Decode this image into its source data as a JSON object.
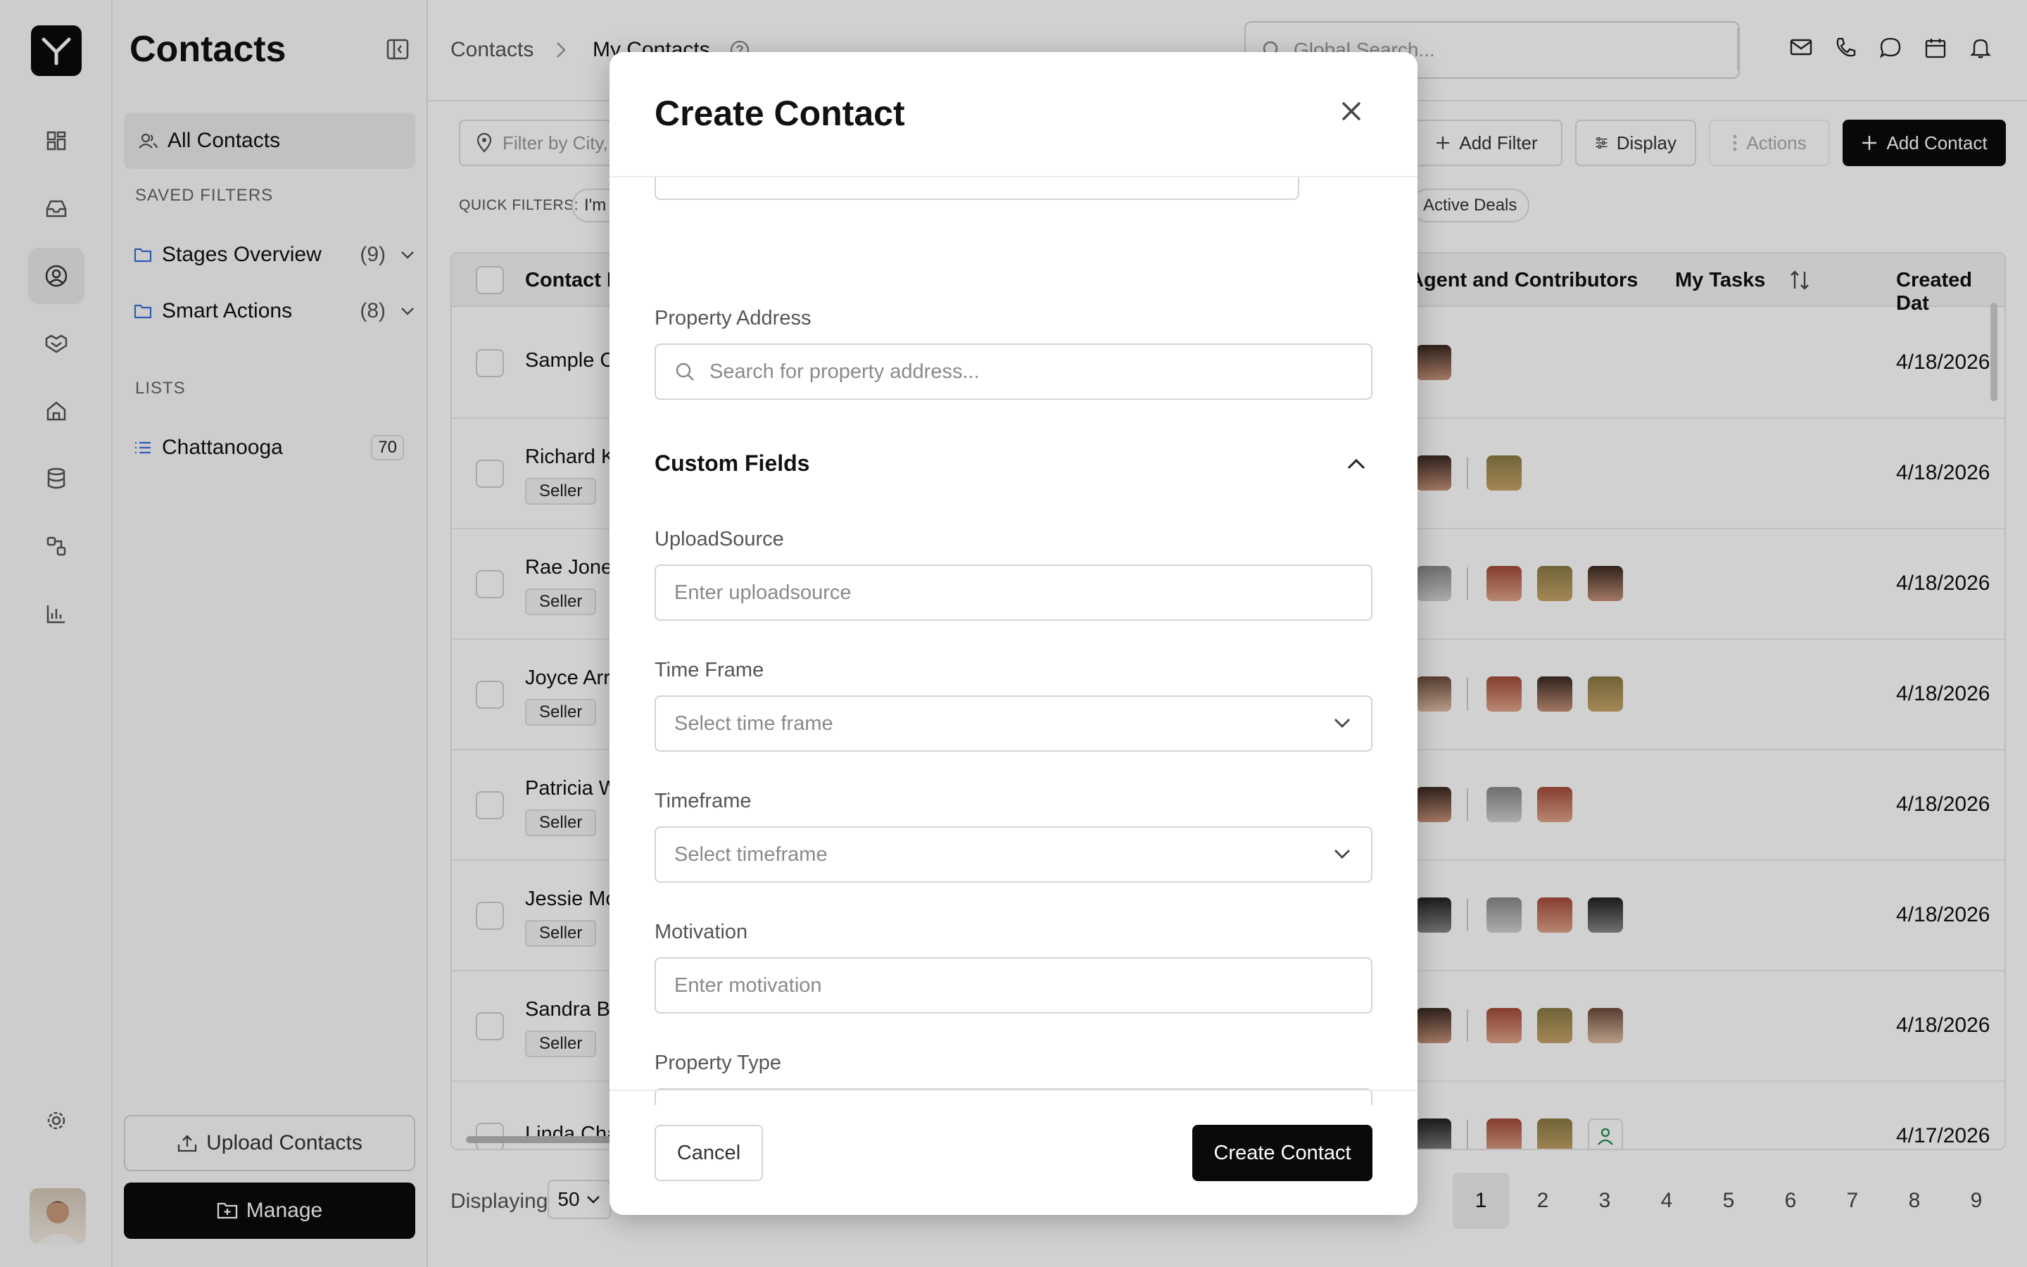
{
  "sidebar": {
    "title": "Contacts",
    "all_contacts": "All Contacts",
    "saved_filters_heading": "SAVED FILTERS",
    "saved_filters": [
      {
        "label": "Stages Overview",
        "count": "(9)"
      },
      {
        "label": "Smart Actions",
        "count": "(8)"
      }
    ],
    "lists_heading": "LISTS",
    "lists": [
      {
        "label": "Chattanooga",
        "count": "70"
      }
    ],
    "upload_label": "Upload Contacts",
    "manage_label": "Manage"
  },
  "header": {
    "breadcrumb_root": "Contacts",
    "breadcrumb_current": "My Contacts",
    "global_search_placeholder": "Global Search..."
  },
  "toolbar": {
    "filter_placeholder": "Filter by City, S",
    "add_filter": "Add Filter",
    "display": "Display",
    "actions": "Actions",
    "add_contact": "Add Contact",
    "quick_filters_label": "QUICK FILTERS:",
    "chip_left": "I'm",
    "chip_right": "Active Deals"
  },
  "table": {
    "headers": {
      "name": "Contact N",
      "agents": "Agent and Contributors",
      "tasks": "My Tasks",
      "created": "Created Dat"
    },
    "rows": [
      {
        "name": "Sample C",
        "tag": "",
        "date": "4/18/2026"
      },
      {
        "name": "Richard K",
        "tag": "Seller",
        "date": "4/18/2026"
      },
      {
        "name": "Rae Jone",
        "tag": "Seller",
        "date": "4/18/2026"
      },
      {
        "name": "Joyce Arr",
        "tag": "Seller",
        "date": "4/18/2026"
      },
      {
        "name": "Patricia W",
        "tag": "Seller",
        "date": "4/18/2026"
      },
      {
        "name": "Jessie Mc",
        "tag": "Seller",
        "date": "4/18/2026"
      },
      {
        "name": "Sandra Ba",
        "tag": "Seller",
        "date": "4/18/2026"
      },
      {
        "name": "Linda Cha",
        "tag": "",
        "date": "4/17/2026"
      }
    ]
  },
  "pagination": {
    "displaying_label": "Displaying",
    "page_size": "50",
    "pages": [
      "1",
      "2",
      "3",
      "4",
      "5",
      "6",
      "7",
      "8",
      "9"
    ],
    "current_page": "1"
  },
  "modal": {
    "title": "Create Contact",
    "property_address_label": "Property Address",
    "property_address_placeholder": "Search for property address...",
    "custom_fields_heading": "Custom Fields",
    "upload_source_label": "UploadSource",
    "upload_source_placeholder": "Enter uploadsource",
    "time_frame_label": "Time Frame",
    "time_frame_placeholder": "Select time frame",
    "timeframe_label": "Timeframe",
    "timeframe_placeholder": "Select timeframe",
    "motivation_label": "Motivation",
    "motivation_placeholder": "Enter motivation",
    "property_type_label": "Property Type",
    "cancel": "Cancel",
    "create": "Create Contact"
  }
}
